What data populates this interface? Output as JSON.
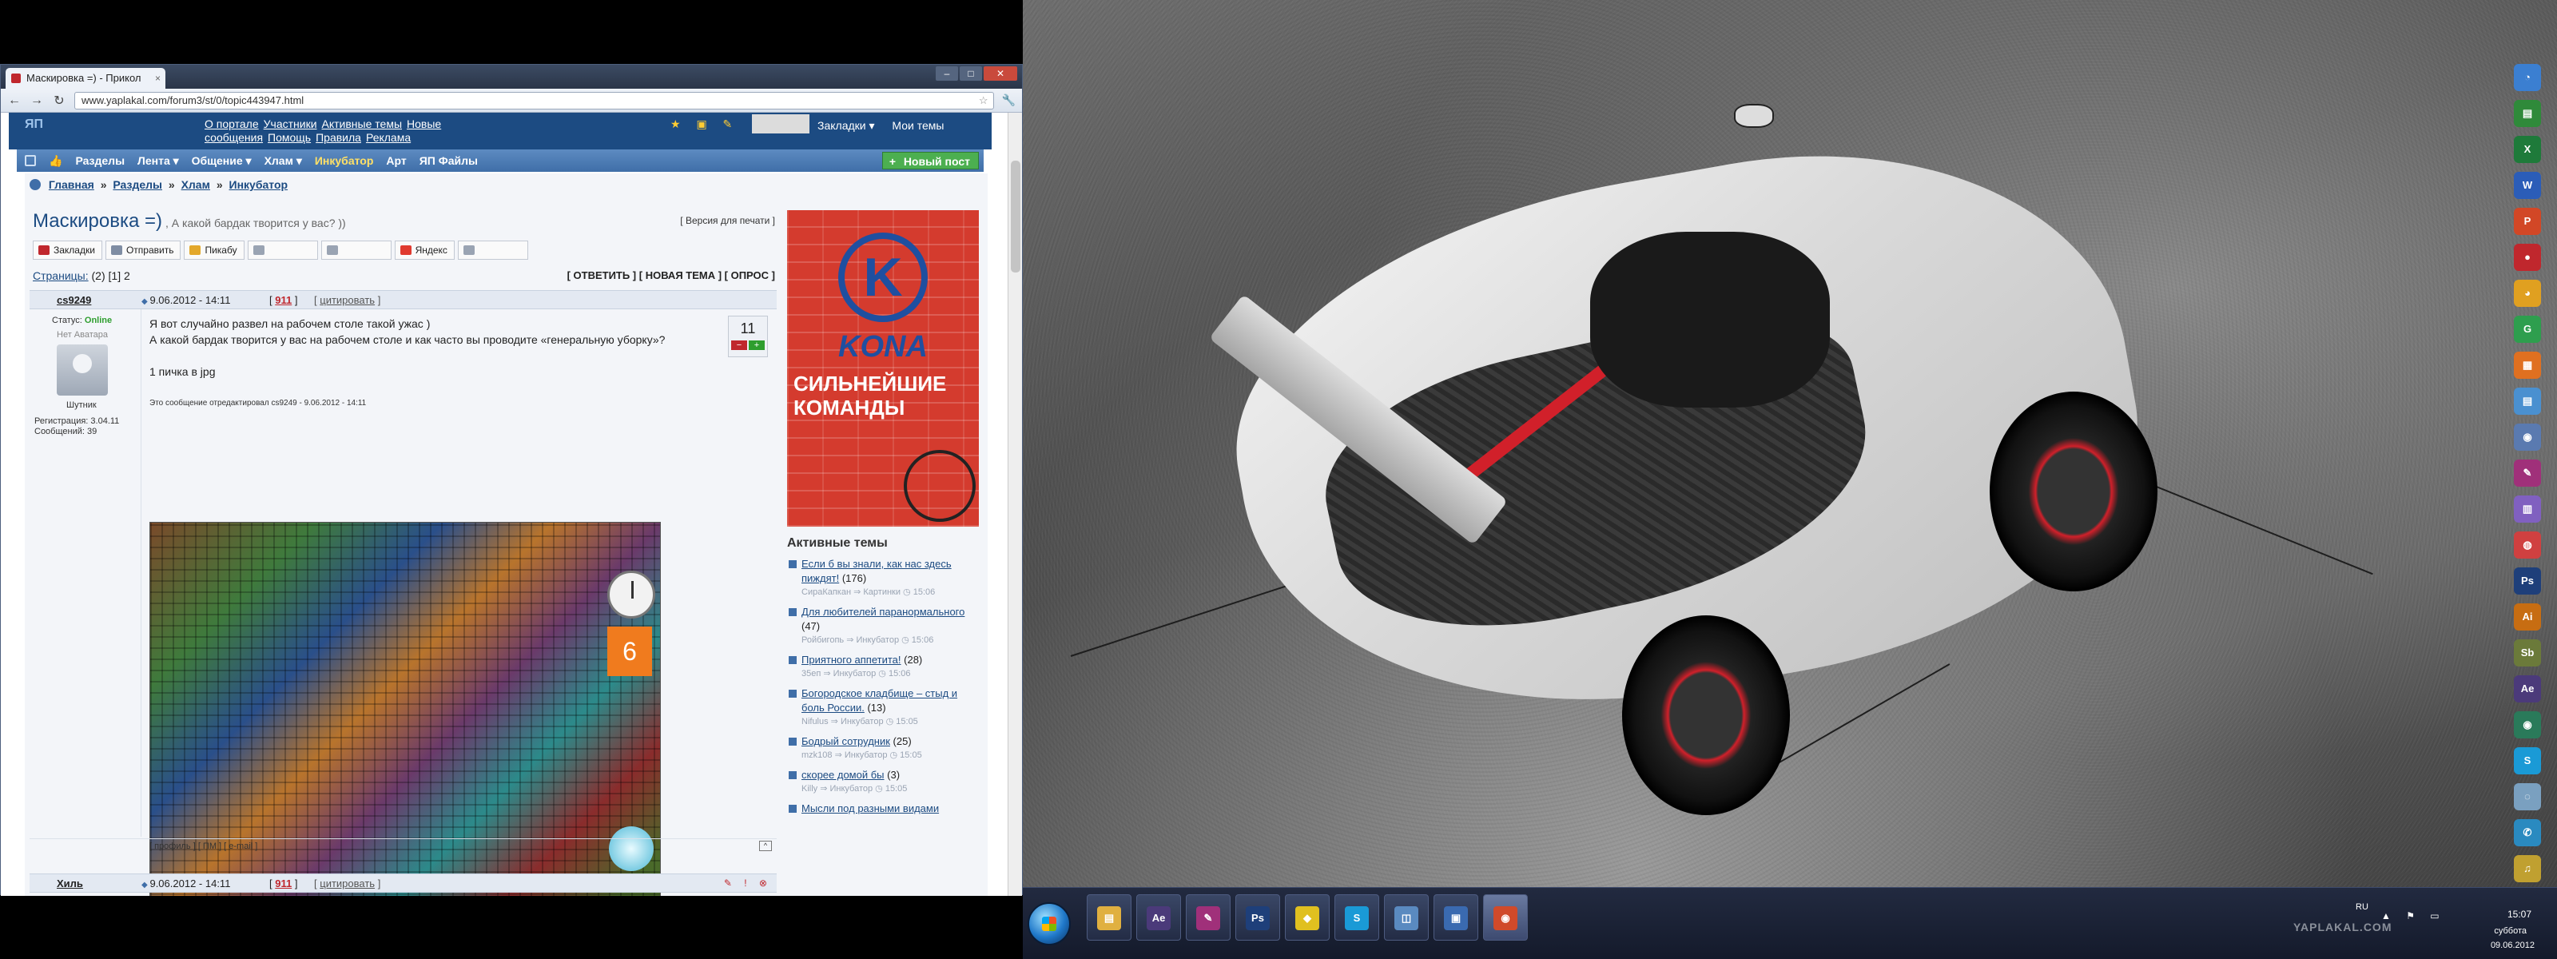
{
  "browser": {
    "tab_title": "Маскировка =) - Прикол",
    "tab_close": "×",
    "url": "www.yaplakal.com/forum3/st/0/topic443947.html",
    "min": "–",
    "max": "□",
    "close": "✕",
    "back": "←",
    "forward": "→",
    "reload": "↻",
    "star": "☆",
    "wrench": "🔧"
  },
  "site": {
    "logo": "ЯП",
    "top_links": [
      "О портале",
      "Участники",
      "Активные темы",
      "Новые сообщения",
      "Помощь",
      "Правила",
      "Реклама"
    ],
    "head_icons": "★ ▣ ✎",
    "head_menu": [
      "Закладки ▾",
      "Мои темы"
    ],
    "nav": [
      "Разделы",
      "Лента ▾",
      "Общение ▾",
      "Хлам ▾",
      "Инкубатор",
      "Арт",
      "ЯП Файлы"
    ],
    "new_post": "Новый пост"
  },
  "breadcrumb": [
    "Главная",
    "Разделы",
    "Хлам",
    "Инкубатор"
  ],
  "breadcrumb_sep": "»",
  "topic": {
    "title": "Маскировка =)",
    "subtitle": ", А какой бардак творится у вас? ))",
    "print_version": "[ Версия для печати ]",
    "share": [
      {
        "label": "Закладки",
        "color": "#c0272d"
      },
      {
        "label": "Отправить",
        "color": "#7f8da3"
      },
      {
        "label": "Пикабу",
        "color": "#e3a82b"
      },
      {
        "label": "",
        "color": "#9aa4b3"
      },
      {
        "label": "",
        "color": "#9aa4b3"
      },
      {
        "label": "Яндекс",
        "color": "#e03a2f"
      },
      {
        "label": "",
        "color": "#9aa4b3"
      }
    ],
    "pages_label": "Страницы:",
    "pages_value": "(2) [1] 2",
    "actions": "[ ОТВЕТИТЬ ] [ НОВАЯ ТЕМА ] [ ОПРОС ]"
  },
  "post1": {
    "author": "cs9249",
    "time": "9.06.2012 - 14:11",
    "num_prefix": "[",
    "num": "911",
    "num_suffix": "]",
    "quote_open": "[",
    "quote": "цитировать",
    "quote_close": "]",
    "status_label": "Статус:",
    "status_value": "Online",
    "no_avatar": "Нет Аватара",
    "rank": "Шутник",
    "registered": "Регистрация: 3.04.11",
    "messages": "Сообщений: 39",
    "line1": "Я вот случайно развел на рабочем столе такой ужас )",
    "line2": "А какой бардак творится у вас на рабочем столе и как часто вы проводите «генеральную уборку»?",
    "line3": "1 пичка в jpg",
    "edited": "Это сообщение отредактировал cs9249 - 9.06.2012 - 14:11",
    "rating": "11",
    "rate_minus": "−",
    "rate_plus": "+",
    "calendar_day": "6",
    "footer_links": "[ профиль ] [ ПМ ] [ e-mail ]",
    "up": "^"
  },
  "post2": {
    "author": "Хиль",
    "time": "9.06.2012 - 14:11",
    "num_prefix": "[",
    "num": "911",
    "num_suffix": "]",
    "quote_open": "[",
    "quote": "цитировать",
    "quote_close": "]",
    "tools": "✎ ! ⊗"
  },
  "ad": {
    "letter": "K",
    "brand": "KONA",
    "slogan": "СИЛЬНЕЙШИЕ КОМАНДЫ"
  },
  "active_topics": {
    "title": "Активные темы",
    "items": [
      {
        "title": "Если б вы знали, как нас здесь пиждят!",
        "count": "(176)",
        "meta": "СираКапкан ⇒ Картинки ◷ 15:06"
      },
      {
        "title": "Для любителей паранормального",
        "count": "(47)",
        "meta": "Ройбигопь ⇒ Инкубатор ◷ 15:06"
      },
      {
        "title": "Приятного аппетита!",
        "count": "(28)",
        "meta": "35еп ⇒ Инкубатор ◷ 15:06"
      },
      {
        "title": "Богородское кладбище – стыд и боль России.",
        "count": "(13)",
        "meta": "Nifulus ⇒ Инкубатор ◷ 15:05"
      },
      {
        "title": "Бодрый сотрудник",
        "count": "(25)",
        "meta": "mzk108 ⇒ Инкубатор ◷ 15:05"
      },
      {
        "title": "скорее домой бы",
        "count": "(3)",
        "meta": "Killy ⇒ Инкубатор ◷ 15:05"
      },
      {
        "title": "Мысли под разными видами",
        "count": "",
        "meta": ""
      }
    ]
  },
  "desktop": {
    "gadgets": [
      {
        "label": "◔",
        "color": "#3b7fd1"
      },
      {
        "label": "▤",
        "color": "#2f8a3a"
      },
      {
        "label": "X",
        "color": "#1e7a3a"
      },
      {
        "label": "W",
        "color": "#2b5db8"
      },
      {
        "label": "P",
        "color": "#d24726"
      },
      {
        "label": "●",
        "color": "#c0272d"
      },
      {
        "label": "◕",
        "color": "#e0a020"
      },
      {
        "label": "G",
        "color": "#2e9e4e"
      },
      {
        "label": "▦",
        "color": "#e07020"
      },
      {
        "label": "▤",
        "color": "#4a90d0"
      },
      {
        "label": "◉",
        "color": "#5a7ab0"
      },
      {
        "label": "✎",
        "color": "#a0307a"
      },
      {
        "label": "▥",
        "color": "#8060c0"
      },
      {
        "label": "◍",
        "color": "#d04040"
      },
      {
        "label": "Ps",
        "color": "#1e3f7a"
      },
      {
        "label": "Ai",
        "color": "#c76d12"
      },
      {
        "label": "Sb",
        "color": "#6b7a3a"
      },
      {
        "label": "Ae",
        "color": "#4b3a7a"
      },
      {
        "label": "◉",
        "color": "#2a7a5a"
      },
      {
        "label": "S",
        "color": "#1a9ad6"
      },
      {
        "label": "◌",
        "color": "#7aa0c0"
      },
      {
        "label": "✆",
        "color": "#2a8ac0"
      },
      {
        "label": "♫",
        "color": "#c0a030"
      }
    ],
    "taskbar": [
      {
        "label": "▤",
        "color": "#e0b040"
      },
      {
        "label": "Ae",
        "color": "#4b3a7a"
      },
      {
        "label": "✎",
        "color": "#a0307a"
      },
      {
        "label": "Ps",
        "color": "#1e3f7a"
      },
      {
        "label": "◆",
        "color": "#e0c020"
      },
      {
        "label": "S",
        "color": "#1a9ad6"
      },
      {
        "label": "◫",
        "color": "#5a8ac0"
      },
      {
        "label": "▣",
        "color": "#3a6ab0"
      },
      {
        "label": "◉",
        "color": "#d04a2a"
      }
    ],
    "tray_lang": "RU",
    "tray_icons": "▲ ⚑ ▭",
    "time": "15:07",
    "day": "суббота",
    "date": "09.06.2012",
    "watermark": "YAPLAKAL.COM"
  }
}
